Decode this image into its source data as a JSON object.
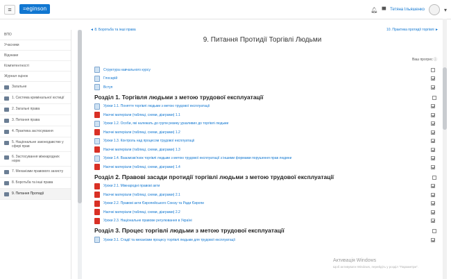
{
  "header": {
    "logo": "=eginson",
    "user_name": "Тетяна Ільяшенко"
  },
  "sidebar": {
    "items": [
      {
        "label": "ВПО",
        "folder": false
      },
      {
        "label": "Учасники",
        "folder": false
      },
      {
        "label": "Відзнаки",
        "folder": false
      },
      {
        "label": "Компетентності",
        "folder": false
      },
      {
        "label": "Журнал оцінок",
        "folder": false
      },
      {
        "label": "Загальне",
        "folder": true
      },
      {
        "label": "1. Система кримінальної юстиції",
        "folder": true
      },
      {
        "label": "2. Загальні права",
        "folder": true
      },
      {
        "label": "3. Питання права",
        "folder": true
      },
      {
        "label": "4. Практика застосування",
        "folder": true
      },
      {
        "label": "5. Національне законодавство у сфері прав",
        "folder": true
      },
      {
        "label": "6. Застосування міжнародних норм",
        "folder": true
      },
      {
        "label": "7. Механізми правового захисту",
        "folder": true
      },
      {
        "label": "8. Боротьба та інші права",
        "folder": true
      },
      {
        "label": "9. Питання Протидії",
        "folder": true,
        "active": true
      }
    ]
  },
  "main": {
    "prev_link": "◄ 8. Боротьба та інші права",
    "next_link": "10. Практика протидії торгівлі ►",
    "title": "9. Питання Протидії Торгівлі Людьми",
    "progress_label": "Ваш прогрес ⓘ",
    "top_items": [
      {
        "icon": "doc",
        "text": "Структура навчального курсу",
        "done": false
      },
      {
        "icon": "doc",
        "text": "Глосарій",
        "done": true
      },
      {
        "icon": "doc",
        "text": "Вступ",
        "done": true
      }
    ],
    "sections": [
      {
        "title": "Розділ 1. Торгівля людьми з метою трудової експлуатації",
        "done": false,
        "items": [
          {
            "icon": "doc",
            "text": "Уроки 1.1. Поняття торгівлі людьми з метою трудової експлуатації",
            "done": true
          },
          {
            "icon": "pdf",
            "text": "Наочні матеріали (таблиці, схеми, діаграми) 1.1",
            "done": true
          },
          {
            "icon": "doc",
            "text": "Уроки 1.2. Особи, які належать до групи ризику уразливих до торгівлі людьми",
            "done": true
          },
          {
            "icon": "pdf",
            "text": "Наочні матеріали (таблиці, схеми, діаграми) 1.2",
            "done": true
          },
          {
            "icon": "doc",
            "text": "Уроки 1.3. Контроль над процесом трудової експлуатації",
            "done": true
          },
          {
            "icon": "pdf",
            "text": "Наочні матеріали (таблиці, схеми, діаграми) 1.3",
            "done": true
          },
          {
            "icon": "doc",
            "text": "Уроки 1.4. Взаємозв’язок торгівлі людьми з метою трудової експлуатації з іншими формами порушення прав людини",
            "done": true
          },
          {
            "icon": "pdf",
            "text": "Наочні матеріали (таблиці, схеми, діаграми) 1.4",
            "done": true
          }
        ]
      },
      {
        "title": "Розділ 2. Правові засади протидії торгівлі людьми з метою трудової експлуатації",
        "done": false,
        "items": [
          {
            "icon": "pdf",
            "text": "Уроки 2.1. Міжнародні правові акти",
            "done": true
          },
          {
            "icon": "pdf",
            "text": "Наочні матеріали (таблиці, схеми, діаграми) 2.1",
            "done": true
          },
          {
            "icon": "pdf",
            "text": "Уроки 2.2. Правові акти Європейського Союзу та Ради Європи",
            "done": true
          },
          {
            "icon": "pdf",
            "text": "Наочні матеріали (таблиці, схеми, діаграми) 2.2",
            "done": true
          },
          {
            "icon": "pdf",
            "text": "Уроки 2.3. Національне правове регулювання в Україні",
            "done": true
          }
        ]
      },
      {
        "title": "Розділ 3. Процес торгівлі людьми з метою трудової експлуатації",
        "done": false,
        "items": [
          {
            "icon": "doc",
            "text": "Уроки 3.1. Стадії та механізми процесу торгівлі людьми для трудової експлуатації",
            "done": true
          }
        ]
      }
    ]
  },
  "watermark": {
    "title": "Активація Windows",
    "subtitle": "Щоб активувати Windows, перейдіть у розділ \"Параметри\"."
  }
}
